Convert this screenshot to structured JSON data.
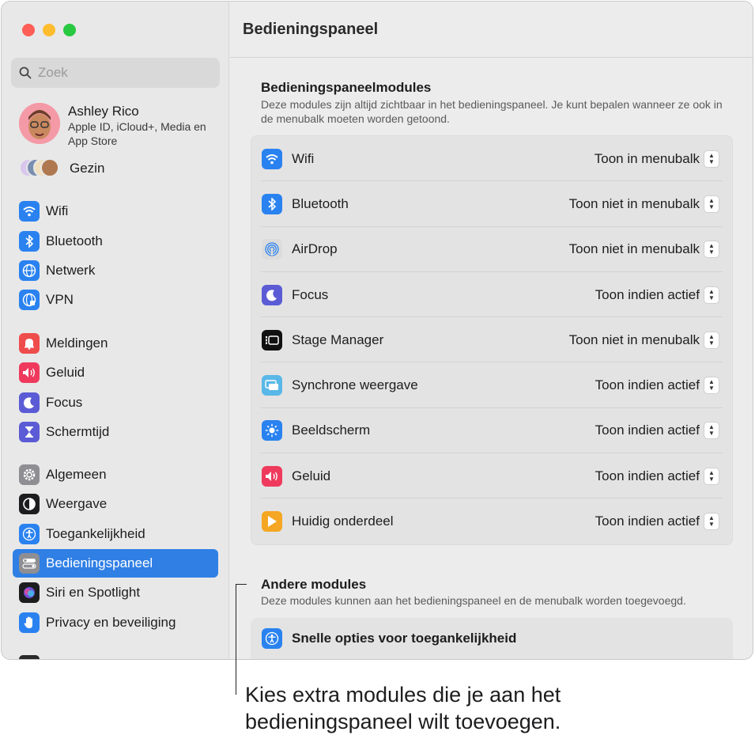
{
  "window": {
    "title": "Bedieningspaneel"
  },
  "sidebar": {
    "search_placeholder": "Zoek",
    "profile": {
      "name": "Ashley Rico",
      "subtitle": "Apple ID, iCloud+, Media en App Store"
    },
    "family_label": "Gezin",
    "items": [
      {
        "label": "Wifi",
        "icon": "wifi-icon",
        "color": "#2a82f0"
      },
      {
        "label": "Bluetooth",
        "icon": "bluetooth-icon",
        "color": "#2a82f0"
      },
      {
        "label": "Netwerk",
        "icon": "globe-icon",
        "color": "#2a82f0"
      },
      {
        "label": "VPN",
        "icon": "vpn-globe-icon",
        "color": "#2a82f0"
      },
      {
        "label": "Meldingen",
        "icon": "bell-icon",
        "color": "#ef4c4c"
      },
      {
        "label": "Geluid",
        "icon": "speaker-icon",
        "color": "#ef3a5d"
      },
      {
        "label": "Focus",
        "icon": "moon-icon",
        "color": "#5b5bd6"
      },
      {
        "label": "Schermtijd",
        "icon": "hourglass-icon",
        "color": "#5b5bd6"
      },
      {
        "label": "Algemeen",
        "icon": "gear-icon",
        "color": "#8e8e93"
      },
      {
        "label": "Weergave",
        "icon": "appearance-icon",
        "color": "#1d1d1f"
      },
      {
        "label": "Toegankelijkheid",
        "icon": "accessibility-icon",
        "color": "#2a82f0"
      },
      {
        "label": "Bedieningspaneel",
        "icon": "control-center-icon",
        "color": "#8e8e93"
      },
      {
        "label": "Siri en Spotlight",
        "icon": "siri-icon",
        "color": "#1d1d1f"
      },
      {
        "label": "Privacy en beveiliging",
        "icon": "hand-icon",
        "color": "#2a82f0"
      }
    ],
    "selected": "Bedieningspaneel"
  },
  "main": {
    "section1": {
      "title": "Bedieningspaneelmodules",
      "description": "Deze modules zijn altijd zichtbaar in het bedieningspaneel. Je kunt bepalen wanneer ze ook in de menubalk moeten worden getoond."
    },
    "modules": [
      {
        "label": "Wifi",
        "value": "Toon in menubalk",
        "icon": "wifi-icon",
        "color": "#2a82f0"
      },
      {
        "label": "Bluetooth",
        "value": "Toon niet in menubalk",
        "icon": "bluetooth-icon",
        "color": "#2a82f0"
      },
      {
        "label": "AirDrop",
        "value": "Toon niet in menubalk",
        "icon": "airdrop-icon",
        "color": "#dcdcdc"
      },
      {
        "label": "Focus",
        "value": "Toon indien actief",
        "icon": "moon-icon",
        "color": "#5b5bd6"
      },
      {
        "label": "Stage Manager",
        "value": "Toon niet in menubalk",
        "icon": "stage-manager-icon",
        "color": "#111111"
      },
      {
        "label": "Synchrone weergave",
        "value": "Toon indien actief",
        "icon": "screen-mirroring-icon",
        "color": "#5ab8e8"
      },
      {
        "label": "Beeldscherm",
        "value": "Toon indien actief",
        "icon": "sun-icon",
        "color": "#2a82f0"
      },
      {
        "label": "Geluid",
        "value": "Toon indien actief",
        "icon": "speaker-icon",
        "color": "#ef3a5d"
      },
      {
        "label": "Huidig onderdeel",
        "value": "Toon indien actief",
        "icon": "play-icon",
        "color": "#f5a623"
      }
    ],
    "section2": {
      "title": "Andere modules",
      "description": "Deze modules kunnen aan het bedieningspaneel en de menubalk worden toegevoegd."
    },
    "other_modules": [
      {
        "label": "Snelle opties voor toegankelijkheid",
        "icon": "accessibility-icon",
        "color": "#2a82f0"
      }
    ]
  },
  "callout": {
    "text": "Kies extra modules die je aan het bedieningspaneel wilt toevoegen."
  }
}
